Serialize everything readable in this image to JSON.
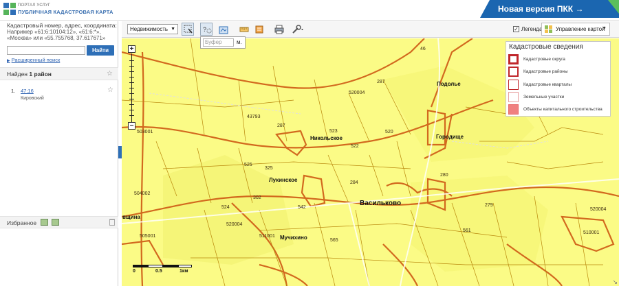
{
  "header": {
    "logo_top": "ПОРТАЛ УСЛУГ",
    "logo_bottom": "ПУБЛИЧНАЯ КАДАСТРОВАЯ КАРТА",
    "new_version": "Новая версия ПКК →",
    "brand_color": "#1b66b0"
  },
  "search": {
    "hint_line1": "Кадастровый номер, адрес, координата:",
    "hint_line2": "Например «61:6:10104:12», «61:6:*»,",
    "hint_line3": "«Москва» или «55.755768, 37.617671»",
    "input_value": "",
    "button": "Найти",
    "advanced": "Расширенный поиск"
  },
  "results": {
    "found_prefix": "Найден ",
    "found_bold": "1 район",
    "items": [
      {
        "num": "1.",
        "code": "47:16",
        "name": "Кировский"
      }
    ]
  },
  "favorites": {
    "label": "Избранное"
  },
  "toolbar": {
    "layer_select": "Недвижимость",
    "legend_label": "Легенда",
    "legend_checked": true,
    "map_control": "Управление картой",
    "buffer_placeholder": "Буфер",
    "buffer_unit": "м."
  },
  "legend": {
    "title": "Кадастровые сведения",
    "items": [
      {
        "label": "Кадастровые округа",
        "color": "#c0262b",
        "border": 3,
        "fill": "#ffffff"
      },
      {
        "label": "Кадастровые районы",
        "color": "#c0262b",
        "border": 2,
        "fill": "#ffffff"
      },
      {
        "label": "Кадастровые кварталы",
        "color": "#c0262b",
        "border": 1,
        "fill": "#ffffff"
      },
      {
        "label": "Земельные участки",
        "color": "#e8a0a0",
        "border": 1,
        "fill": "#ffffff"
      },
      {
        "label": "Объекты капитального строительства",
        "color": "#e86a6a",
        "border": 1,
        "fill": "#f08080"
      }
    ]
  },
  "map": {
    "parcel_labels": [
      "46",
      "287",
      "520004",
      "503001",
      "43793",
      "287",
      "523",
      "520",
      "522",
      "525",
      "325",
      "284",
      "280",
      "279",
      "302",
      "524",
      "542",
      "520004",
      "565",
      "561",
      "504002",
      "505001",
      "511001",
      "520004",
      "510001"
    ],
    "towns": [
      "Подолье",
      "Никольское",
      "Городище",
      "Лукинское",
      "Васильково",
      "Мучихино",
      "вщина"
    ],
    "scale_labels": [
      "0",
      "0.5",
      "1км"
    ]
  }
}
